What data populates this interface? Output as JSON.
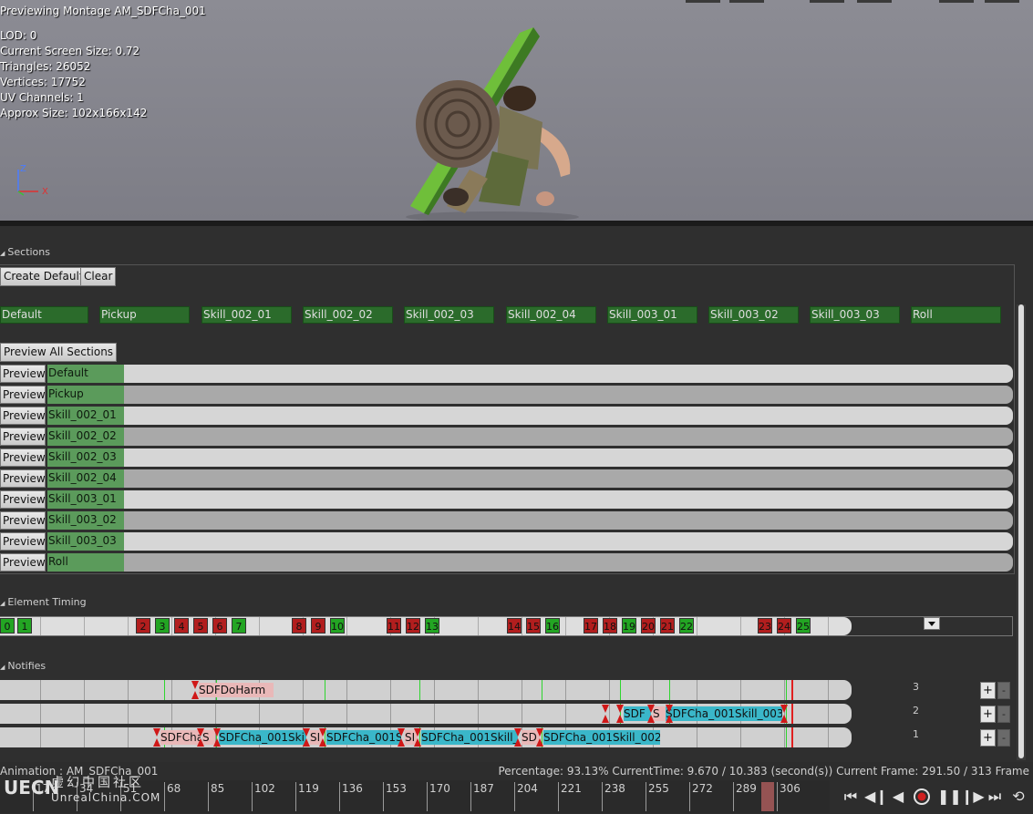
{
  "viewport": {
    "title": "Previewing Montage AM_SDFCha_001",
    "stats": [
      "LOD: 0",
      "Current Screen Size: 0.72",
      "Triangles: 26052",
      "Vertices: 17752",
      "UV Channels: 1",
      "Approx Size: 102x166x142"
    ],
    "axis_z": "Z",
    "axis_x": "X"
  },
  "sections": {
    "header": "Sections",
    "create_default": "Create Default",
    "clear": "Clear",
    "tags": [
      "Default",
      "Pickup",
      "Skill_002_01",
      "Skill_002_02",
      "Skill_002_03",
      "Skill_002_04",
      "Skill_003_01",
      "Skill_003_02",
      "Skill_003_03",
      "Roll"
    ],
    "preview_all": "Preview All Sections",
    "preview_label": "Preview",
    "rows": [
      "Default",
      "Pickup",
      "Skill_002_01",
      "Skill_002_02",
      "Skill_002_03",
      "Skill_002_04",
      "Skill_003_01",
      "Skill_003_02",
      "Skill_003_03",
      "Roll"
    ]
  },
  "element_timing": {
    "header": "Element Timing",
    "markers": [
      {
        "label": "0",
        "color": "g"
      },
      {
        "label": "1",
        "color": "g"
      },
      {
        "label": "2",
        "color": "r"
      },
      {
        "label": "3",
        "color": "g"
      },
      {
        "label": "4",
        "color": "r"
      },
      {
        "label": "5",
        "color": "r"
      },
      {
        "label": "6",
        "color": "r"
      },
      {
        "label": "7",
        "color": "g"
      },
      {
        "label": "8",
        "color": "r"
      },
      {
        "label": "9",
        "color": "r"
      },
      {
        "label": "10",
        "color": "g"
      },
      {
        "label": "11",
        "color": "r"
      },
      {
        "label": "12",
        "color": "r"
      },
      {
        "label": "13",
        "color": "g"
      },
      {
        "label": "14",
        "color": "r"
      },
      {
        "label": "15",
        "color": "r"
      },
      {
        "label": "16",
        "color": "g"
      },
      {
        "label": "17",
        "color": "r"
      },
      {
        "label": "18",
        "color": "r"
      },
      {
        "label": "19",
        "color": "g"
      },
      {
        "label": "20",
        "color": "r"
      },
      {
        "label": "21",
        "color": "r"
      },
      {
        "label": "22",
        "color": "g"
      },
      {
        "label": "23",
        "color": "r"
      },
      {
        "label": "24",
        "color": "r"
      },
      {
        "label": "25",
        "color": "g"
      }
    ]
  },
  "notifies": {
    "header": "Notifies",
    "tracks": [
      {
        "index": "3",
        "blocks": [
          "SDFDoHarm"
        ]
      },
      {
        "index": "2",
        "blocks": [
          "SDF",
          "S",
          "SDFCha_001Skill_003"
        ]
      },
      {
        "index": "1",
        "blocks": [
          "SDFCha",
          "S",
          "SDFCha_001Ski",
          "SI",
          "SDFCha_001S",
          "SI",
          "SDFCha_001Skill_",
          "SD",
          "SDFCha_001Skill_002"
        ]
      }
    ],
    "add_label": "+",
    "remove_label": "-"
  },
  "status": {
    "animation": "Animation : AM_SDFCha_001",
    "info": "Percentage: 93.13% CurrentTime: 9.670 / 10.383 (second(s)) Current Frame: 291.50 / 313 Frame"
  },
  "scrubber": {
    "ticks": [
      "17",
      "34",
      "51",
      "68",
      "85",
      "102",
      "119",
      "136",
      "153",
      "170",
      "187",
      "204",
      "221",
      "238",
      "255",
      "272",
      "289",
      "306"
    ]
  },
  "watermark": {
    "mark": "UECN",
    "cn": "虚幻中国社区",
    "en": "UnrealChina.COM"
  },
  "transport": [
    "skip-to-start-icon",
    "step-back-icon",
    "play-reverse-icon",
    "record-icon",
    "pause-icon",
    "step-forward-icon",
    "skip-to-end-icon",
    "loop-icon"
  ]
}
